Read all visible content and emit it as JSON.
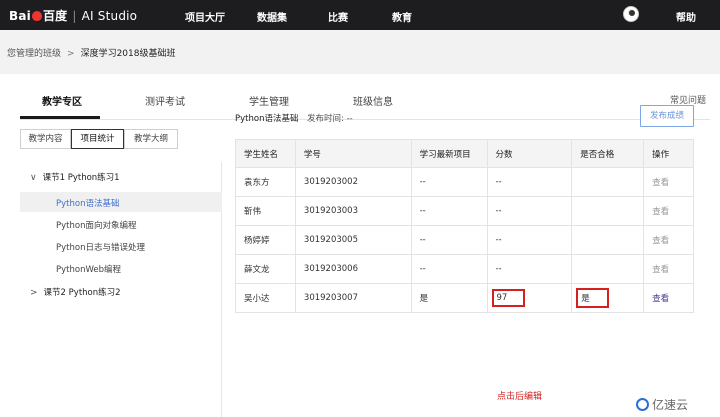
{
  "topbar": {
    "logo_brand": "Bai",
    "logo_cn": "百度",
    "logo_product": "AI Studio",
    "nav": [
      "项目大厅",
      "数据集",
      "比赛",
      "教育"
    ],
    "help": "帮助"
  },
  "breadcrumb": {
    "parent": "您管理的班级",
    "separator": ">",
    "current": "深度学习2018级基础班"
  },
  "tabs": {
    "items": [
      "教学专区",
      "测评考试",
      "学生管理",
      "班级信息"
    ],
    "active": "教学专区",
    "faq": "常见问题"
  },
  "subtabs": {
    "items": [
      "教学内容",
      "项目统计",
      "教学大纲"
    ],
    "active": "项目统计"
  },
  "tree": {
    "sections": [
      {
        "label": "课节1 Python练习1",
        "expanded": true,
        "children": [
          "Python语法基础",
          "Python面向对象编程",
          "Python日志与错误处理",
          "PythonWeb编程"
        ]
      },
      {
        "label": "课节2 Python练习2",
        "expanded": false,
        "children": []
      }
    ],
    "selected": "Python语法基础"
  },
  "panel": {
    "lesson_title": "Python语法基础",
    "publish_time": "发布时间: --",
    "publish_button": "发布成绩"
  },
  "table": {
    "headers": [
      "学生姓名",
      "学号",
      "学习最新项目",
      "分数",
      "是否合格",
      "操作"
    ],
    "rows": [
      [
        "袁东方",
        "3019203002",
        "--",
        "--",
        "",
        "查看"
      ],
      [
        "靳伟",
        "3019203003",
        "--",
        "--",
        "",
        "查看"
      ],
      [
        "杨婷婷",
        "3019203005",
        "--",
        "--",
        "",
        "查看"
      ],
      [
        "薛文龙",
        "3019203006",
        "--",
        "--",
        "",
        "查看"
      ],
      [
        "吴小达",
        "3019203007",
        "是",
        "97",
        "是",
        "查看"
      ]
    ]
  },
  "annotation": {
    "hint": "点击后编辑",
    "color": "#d42020"
  },
  "watermark": "亿速云",
  "colors": {
    "topbar": "#1d1d1f",
    "accent": "#3f6fd0",
    "highlight": "#d42020"
  }
}
